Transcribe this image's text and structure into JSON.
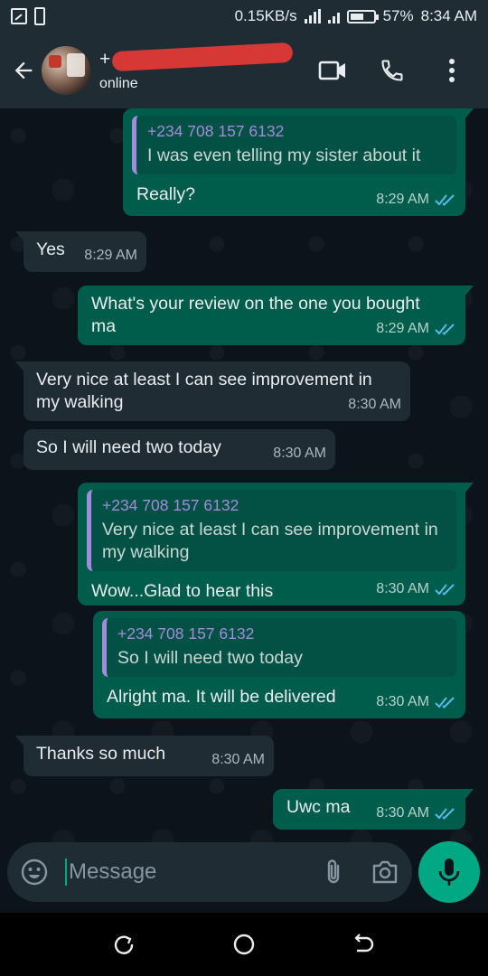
{
  "status_bar": {
    "speed": "0.15KB/s",
    "battery": "57%",
    "time": "8:34 AM"
  },
  "header": {
    "name_visible": "+",
    "status": "online"
  },
  "messages": [
    {
      "dir": "out",
      "quote_author": "+234 708 157 6132",
      "quote_text": "I was even telling  my sister  about it",
      "text": "Really?",
      "time": "8:29 AM"
    },
    {
      "dir": "in",
      "text": "Yes",
      "time": "8:29 AM"
    },
    {
      "dir": "out",
      "text": "What's your review on the one you bought ma",
      "time": "8:29 AM"
    },
    {
      "dir": "in",
      "text": "Very nice at least  I can see improvement in my walking",
      "time": "8:30 AM"
    },
    {
      "dir": "in",
      "text": "So I will  need  two today",
      "time": "8:30 AM"
    },
    {
      "dir": "out",
      "quote_author": "+234 708 157 6132",
      "quote_text": "Very nice at least  I can see improvement in my walking",
      "text": "Wow...Glad to hear this",
      "time": "8:30 AM"
    },
    {
      "dir": "out",
      "quote_author": "+234 708 157 6132",
      "quote_text": "So I will  need  two today",
      "text": "Alright ma. It will be delivered",
      "time": "8:30 AM"
    },
    {
      "dir": "in",
      "text": "Thanks  so  much",
      "time": "8:30 AM"
    },
    {
      "dir": "out",
      "text": "Uwc ma",
      "time": "8:30 AM"
    }
  ],
  "composer": {
    "placeholder": "Message"
  },
  "colors": {
    "outgoing_bubble": "#005c4b",
    "incoming_bubble": "#202c33",
    "quote_author": "#a28bd9",
    "accent": "#00a884",
    "read_ticks": "#53bdeb"
  },
  "icons": [
    "back-arrow-icon",
    "video-call-icon",
    "phone-icon",
    "more-options-icon",
    "emoji-icon",
    "attach-icon",
    "camera-icon",
    "mic-icon",
    "double-check-icon",
    "recents-icon",
    "home-icon",
    "back-nav-icon"
  ]
}
